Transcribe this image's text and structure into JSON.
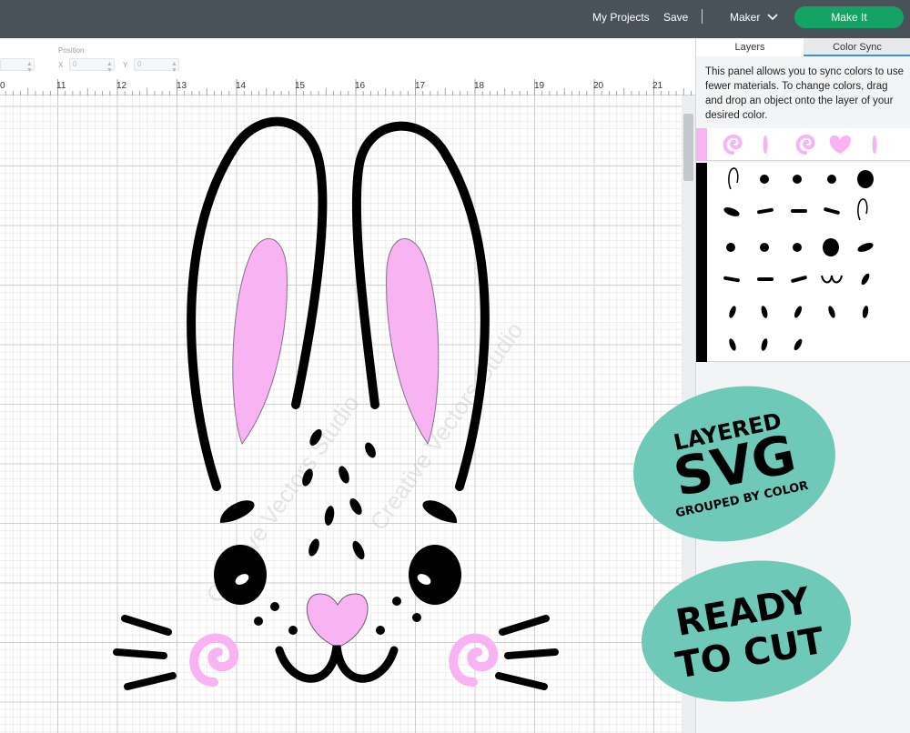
{
  "header": {
    "my_projects": "My Projects",
    "save": "Save",
    "separator": "|",
    "machine": "Maker",
    "make_it": "Make It"
  },
  "toolbar": {
    "position_label": "Position",
    "x_label": "X",
    "x_value": "0",
    "y_label": "Y",
    "y_value": "0"
  },
  "ruler": {
    "ticks": [
      "0",
      "11",
      "12",
      "13",
      "14",
      "15",
      "16",
      "17",
      "18",
      "19",
      "20",
      "21"
    ]
  },
  "panel": {
    "tabs": [
      "Layers",
      "Color Sync"
    ],
    "active_tab": "Color Sync",
    "description": "This panel allows you to sync colors to use fewer materials. To change colors, drag and drop an object onto the layer of your desired color.",
    "layers": [
      {
        "color": "#f7b3f2",
        "objects": [
          "swirl",
          "stroke",
          "swirl",
          "heart",
          "stroke"
        ]
      },
      {
        "color": "#000000",
        "objects": [
          "ear-outline",
          "dot",
          "dot",
          "dot",
          "eye",
          "dash",
          "dash",
          "dash",
          "dash",
          "ear-outline",
          "dot",
          "dot",
          "dot",
          "eye",
          "dash",
          "dash",
          "dash",
          "dash",
          "smile",
          "spot",
          "spot",
          "spot",
          "spot",
          "spot",
          "spot",
          "spot",
          "spot",
          "spot"
        ]
      }
    ]
  },
  "badges": {
    "layered_line1": "LAYERED",
    "layered_line2": "SVG",
    "layered_line3": "GROUPED BY COLOR",
    "ready_line1": "READY",
    "ready_line2": "TO CUT"
  },
  "watermark": "Creative Vectors Studio",
  "colors": {
    "topbar": "#4a5259",
    "make_button": "#14a364",
    "ear_pink": "#f7b3f2",
    "badge_teal": "#6ec9b8",
    "grid_major": "#cfcfcf",
    "grid_minor": "#ececec"
  },
  "icons": [
    "chevron-down-icon",
    "stepper-arrows-icon"
  ]
}
